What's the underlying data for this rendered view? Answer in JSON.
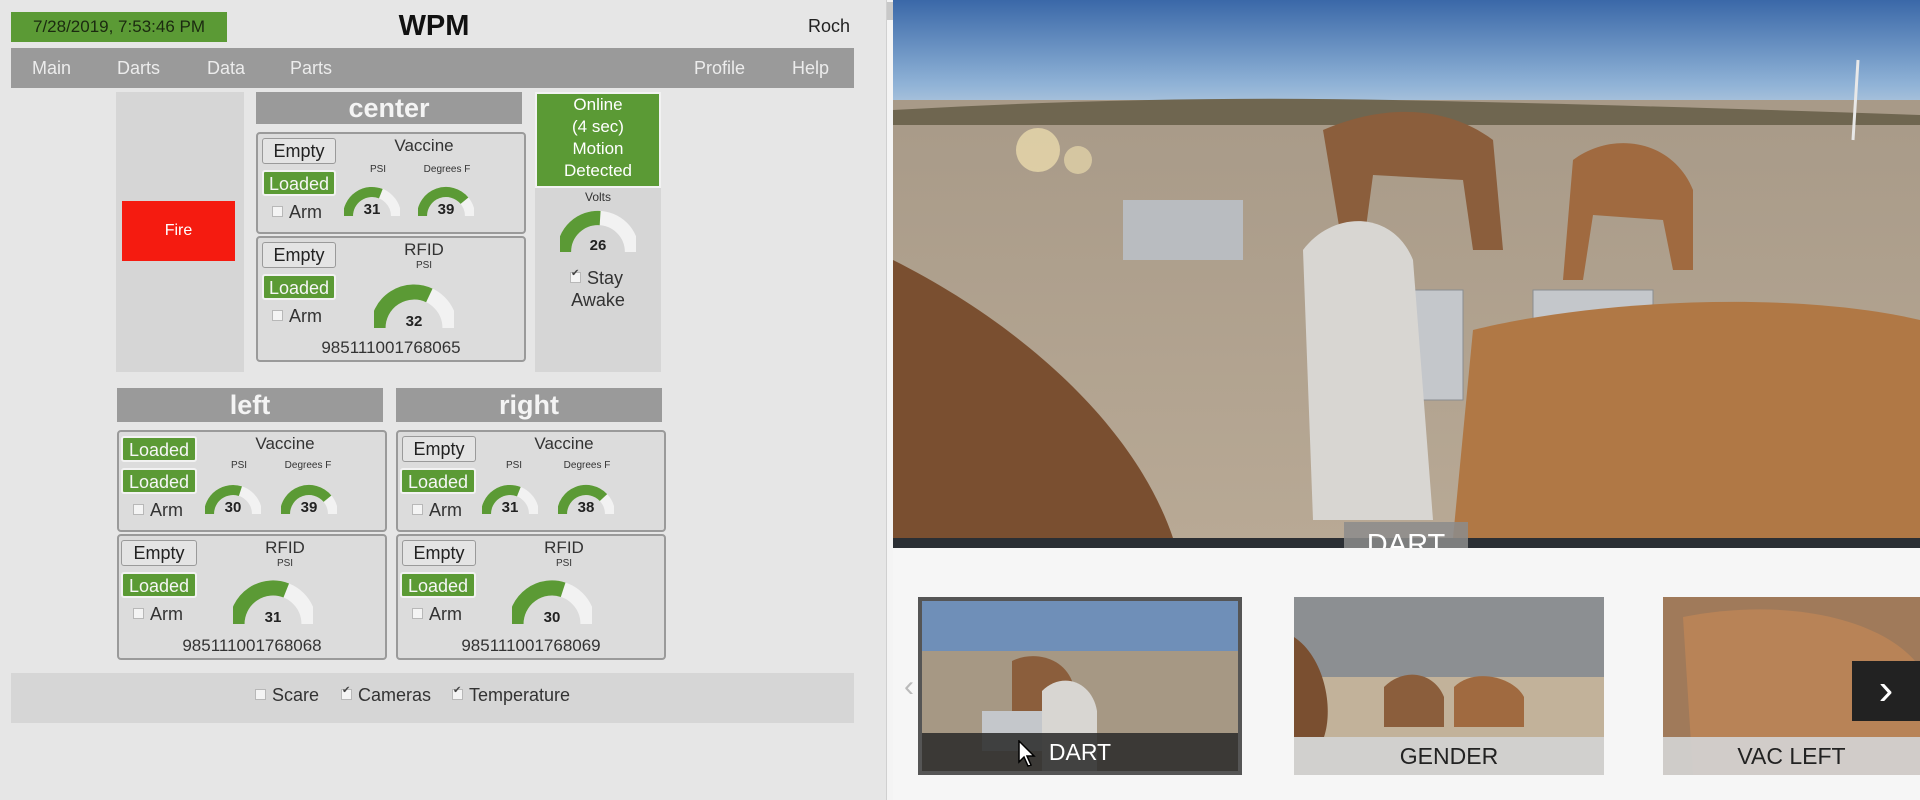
{
  "header": {
    "datetime": "7/28/2019, 7:53:46 PM",
    "title": "WPM",
    "user": "Roch"
  },
  "nav": {
    "left": [
      "Main",
      "Darts",
      "Data",
      "Parts"
    ],
    "right": [
      "Profile",
      "Help"
    ]
  },
  "fire": {
    "label": "Fire",
    "color": "#f51b10"
  },
  "status": {
    "lines": [
      "Online",
      "(4 sec)",
      "Motion",
      "Detected"
    ],
    "volts_label": "Volts",
    "volts_value": 26,
    "stay_awake": [
      "Stay",
      "Awake"
    ],
    "stay_awake_checked": true
  },
  "center": {
    "title": "center",
    "vaccine": {
      "title": "Vaccine",
      "psi_label": "PSI",
      "deg_label": "Degrees F",
      "psi": 31,
      "deg": 39,
      "top_button": "Empty",
      "bottom_button": "Loaded",
      "arm_label": "Arm"
    },
    "rfid": {
      "title": "RFID",
      "psi_label": "PSI",
      "psi": 32,
      "top_button": "Empty",
      "bottom_button": "Loaded",
      "arm_label": "Arm",
      "tag": "985111001768065"
    }
  },
  "left": {
    "title": "left",
    "vaccine": {
      "title": "Vaccine",
      "psi_label": "PSI",
      "deg_label": "Degrees F",
      "psi": 30,
      "deg": 39,
      "top_button": "Loaded",
      "bottom_button": "Loaded",
      "arm_label": "Arm"
    },
    "rfid": {
      "title": "RFID",
      "psi_label": "PSI",
      "psi": 31,
      "top_button": "Empty",
      "bottom_button": "Loaded",
      "arm_label": "Arm",
      "tag": "985111001768068"
    }
  },
  "right": {
    "title": "right",
    "vaccine": {
      "title": "Vaccine",
      "psi_label": "PSI",
      "deg_label": "Degrees F",
      "psi": 31,
      "deg": 38,
      "top_button": "Empty",
      "bottom_button": "Loaded",
      "arm_label": "Arm"
    },
    "rfid": {
      "title": "RFID",
      "psi_label": "PSI",
      "psi": 30,
      "top_button": "Empty",
      "bottom_button": "Loaded",
      "arm_label": "Arm",
      "tag": "985111001768069"
    }
  },
  "gauge_max": 50,
  "footer": {
    "scare": "Scare",
    "cameras": "Cameras",
    "temperature": "Temperature"
  },
  "camera": {
    "main_label": "DART",
    "thumbnails": [
      "DART",
      "GENDER",
      "VAC LEFT"
    ],
    "selected": "DART"
  },
  "colors": {
    "green": "#5b9a35",
    "gray": "#9a9a9a"
  }
}
